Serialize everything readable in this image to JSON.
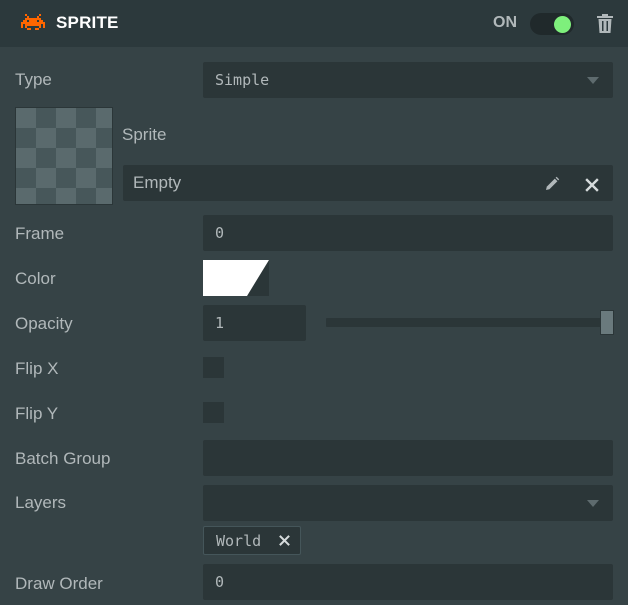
{
  "header": {
    "title": "SPRITE",
    "logo_icon": "space-invader-icon",
    "enabled_label": "ON",
    "enabled": true,
    "delete_icon": "trash-icon",
    "accent_color": "#ff6600",
    "toggle_color": "#7ef07c"
  },
  "fields": {
    "type": {
      "label": "Type",
      "value": "Simple"
    },
    "sprite": {
      "label": "Sprite",
      "value": "Empty",
      "edit_icon": "pencil-icon",
      "clear_icon": "close-icon"
    },
    "frame": {
      "label": "Frame",
      "value": "0"
    },
    "color": {
      "label": "Color",
      "value": "#ffffff"
    },
    "opacity": {
      "label": "Opacity",
      "value": "1",
      "slider_fraction": 1.0
    },
    "flip_x": {
      "label": "Flip X",
      "checked": false
    },
    "flip_y": {
      "label": "Flip Y",
      "checked": false
    },
    "batch_group": {
      "label": "Batch Group",
      "value": ""
    },
    "layers": {
      "label": "Layers",
      "value": "",
      "tags": [
        "World"
      ],
      "remove_icon": "close-icon"
    },
    "draw_order": {
      "label": "Draw Order",
      "value": "0"
    }
  }
}
